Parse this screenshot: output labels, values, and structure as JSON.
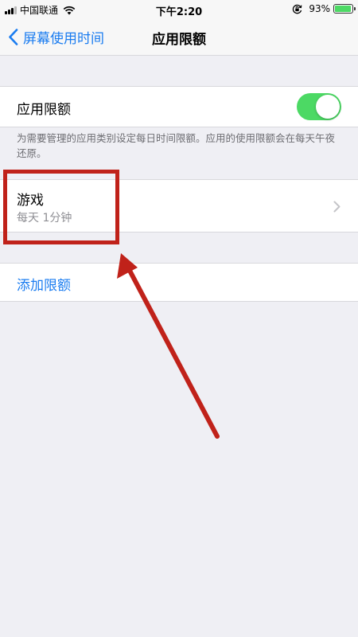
{
  "status_bar": {
    "carrier": "中国联通",
    "time": "下午2:20",
    "battery_percent": "93%",
    "battery_level": 0.93,
    "signal_bars": 3,
    "signal_total": 4
  },
  "nav": {
    "back_label": "屏幕使用时间",
    "title": "应用限额"
  },
  "app_limits": {
    "toggle_label": "应用限额",
    "toggle_on": true,
    "description": "为需要管理的应用类别设定每日时间限额。应用的使用限额会在每天午夜还原。"
  },
  "limits": [
    {
      "name": "游戏",
      "detail": "每天 1分钟"
    }
  ],
  "add_limit_label": "添加限额",
  "colors": {
    "accent": "#1a7cf0",
    "toggle_on": "#4cd964",
    "annotation": "#c0221a",
    "background": "#efeff4"
  },
  "icons": [
    "wifi-icon",
    "orientation-lock-icon",
    "battery-icon",
    "back-chevron-icon",
    "chevron-right-icon"
  ]
}
